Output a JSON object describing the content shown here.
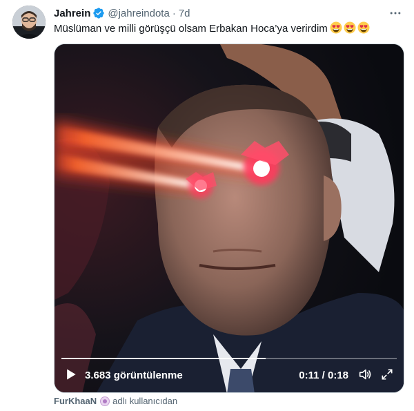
{
  "author": {
    "display_name": "Jahrein",
    "handle": "@jahreindota",
    "separator": "·",
    "time": "7d",
    "verified": true
  },
  "tweet": {
    "text": "Müslüman ve milli görüşçü olsam Erbakan Hoca’ya verirdim",
    "emojis": [
      "heart-eyes-emoji",
      "heart-eyes-emoji",
      "heart-eyes-emoji"
    ]
  },
  "video": {
    "views": "3.683 görüntülenme",
    "time": "0:11 / 0:18",
    "progress_fraction": 0.61
  },
  "attribution": {
    "user": "FurKhaaN",
    "suffix": "adlı kullanıcıdan"
  },
  "colors": {
    "text_primary": "#0f1419",
    "text_secondary": "#536471",
    "verified": "#1d9bf0",
    "border": "#cfd9de"
  },
  "icons": {
    "more": "more-horizontal-icon",
    "verified": "verified-badge-icon",
    "play": "play-icon",
    "volume": "volume-icon",
    "fullscreen": "fullscreen-icon"
  }
}
